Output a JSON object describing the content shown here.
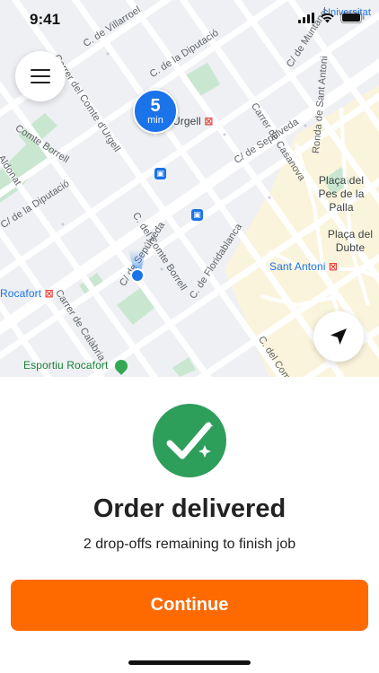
{
  "status_bar": {
    "time": "9:41",
    "icons": [
      "signal-icon",
      "wifi-icon",
      "battery-icon"
    ]
  },
  "map": {
    "labels": {
      "villarroel": "C. de Villarroel",
      "comte_urgell": "Carrer del Comte d'Urgell",
      "urgell_station": "Urgell",
      "diputacio_top": "C. de la Diputació",
      "muntaner": "C/ de Muntaner",
      "casanova": "Carrer de Casanova",
      "sant_antoni_ronda": "Ronda de Sant Antoni",
      "comte_borrell_left": "Comte Borrell",
      "sepulveda_right": "C/ de Sepúlveda",
      "placa_pes_palla": "Plaça del Pes de la Palla",
      "diputacio_left": "C/ de la Diputació",
      "comte_borrell_mid": "C. del Comte Borrell",
      "placa_dubte": "Plaça del Dubte",
      "sant_antoni": "Sant Antoni",
      "floridablanca": "C. de Floridablanca",
      "rocafort_station": "Rocafort",
      "sepulveda_mid": "C/ de Sepúlveda",
      "calabria": "Carrer de Calàbria",
      "comte_borrell_bottom": "C. del Comte Borrell",
      "esportiu_rocafort": "Esportiu Rocafort",
      "universitat": "Universitat",
      "aldonat": "Aldonat"
    },
    "eta": {
      "value": "5",
      "unit": "min"
    },
    "colors": {
      "route_blue": "#1a73e8",
      "park_green": "#c9e7d0",
      "old_town": "#fbf4dc"
    }
  },
  "controls": {
    "menu_icon": "hamburger-menu-icon",
    "locate_icon": "navigation-arrow-icon"
  },
  "sheet": {
    "badge_icon": "check-sparkle-icon",
    "title": "Order delivered",
    "subtitle": "2 drop-offs remaining to finish job",
    "continue_label": "Continue"
  },
  "theme": {
    "accent": "#ff6a00",
    "success": "#2e9e5b"
  }
}
